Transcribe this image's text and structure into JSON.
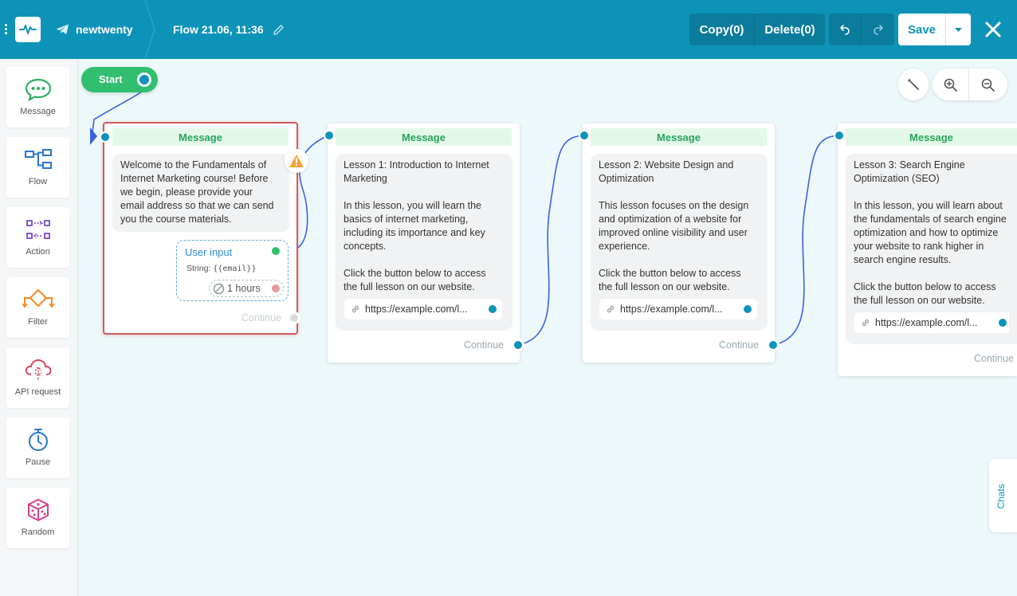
{
  "header": {
    "bot_name": "newtwenty",
    "flow_name": "Flow 21.06, 11:36",
    "copy_label": "Copy(0)",
    "delete_label": "Delete(0)",
    "save_label": "Save",
    "icons": [
      "more-vertical-icon",
      "pulse-logo-icon",
      "telegram-icon",
      "pencil-icon",
      "undo-icon",
      "redo-icon",
      "caret-down-icon",
      "close-icon"
    ]
  },
  "sidebar": {
    "items": [
      {
        "label": "Message",
        "icon": "chat-bubble-icon"
      },
      {
        "label": "Flow",
        "icon": "flow-icon"
      },
      {
        "label": "Action",
        "icon": "action-icon"
      },
      {
        "label": "Filter",
        "icon": "filter-icon"
      },
      {
        "label": "API request",
        "icon": "cloud-api-icon"
      },
      {
        "label": "Pause",
        "icon": "stopwatch-icon"
      },
      {
        "label": "Random",
        "icon": "dice-icon"
      }
    ]
  },
  "canvas": {
    "start_label": "Start",
    "continue_label": "Continue",
    "chats_label": "Chats",
    "zoom_icons": [
      "magic-wand-icon",
      "zoom-in-icon",
      "zoom-out-icon"
    ]
  },
  "nodes": [
    {
      "title": "Message",
      "text": "Welcome to the Fundamentals of\nInternet Marketing course! Before\nwe begin, please provide your\nemail address so that we can send\nyou the course materials.",
      "user_input": {
        "title": "User input",
        "type_label": "String:",
        "variable": "{{email}}",
        "timeout": "1 hours"
      }
    },
    {
      "title": "Message",
      "text": "Lesson 1: Introduction to Internet\nMarketing\n\nIn this lesson, you will learn the\nbasics of internet marketing,\nincluding its importance and key\nconcepts.\n\nClick the button below to access\nthe full lesson on our website.",
      "link": "https://example.com/l..."
    },
    {
      "title": "Message",
      "text": "Lesson 2: Website Design and\nOptimization\n\nThis lesson focuses on the design\nand optimization of a website for\nimproved online visibility and user\nexperience.\n\nClick the button below to access\nthe full lesson on our website.",
      "link": "https://example.com/l..."
    },
    {
      "title": "Message",
      "text": "Lesson 3: Search Engine\nOptimization (SEO)\n\nIn this lesson, you will learn about\nthe fundamentals of search engine\noptimization and how to optimize\nyour website to rank higher in\nsearch engine results.\n\nClick the button below to access\nthe full lesson on our website.",
      "link": "https://example.com/l..."
    }
  ],
  "colors": {
    "header": "#0e93b8",
    "canvas": "#ecf8f9",
    "start": "#2fbf6f",
    "title_bg": "#e3f8e9",
    "title_text": "#27a55a",
    "selected_border": "#d3585f",
    "wire": "#3b63e0"
  }
}
